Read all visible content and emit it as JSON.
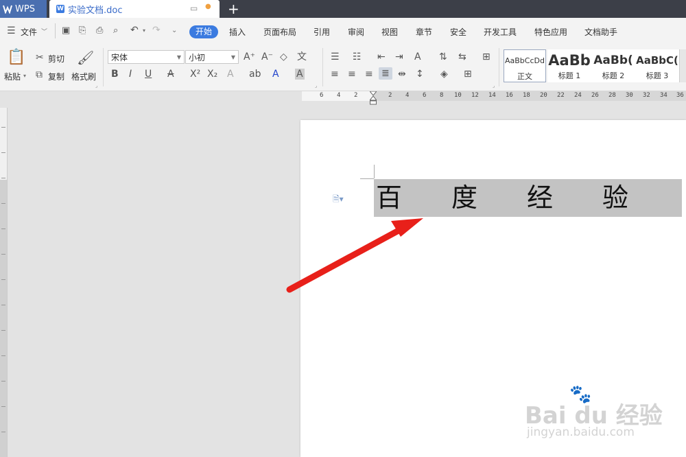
{
  "titlebar": {
    "app_tab": "WPS",
    "doc_tab": "实验文档.doc",
    "new_tab_symbol": "+"
  },
  "menubar": {
    "file_label": "文件",
    "items": [
      "开始",
      "插入",
      "页面布局",
      "引用",
      "审阅",
      "视图",
      "章节",
      "安全",
      "开发工具",
      "特色应用",
      "文档助手"
    ],
    "accent_color": "#3b7be0"
  },
  "toolbar": {
    "paste": "粘贴",
    "cut": "剪切",
    "copy": "复制",
    "format_painter": "格式刷",
    "font_name": "宋体",
    "font_size": "小初",
    "styles": [
      {
        "sample": "AaBbCcDd",
        "name": "正文"
      },
      {
        "sample": "AaBb",
        "name": "标题 1"
      },
      {
        "sample": "AaBb(",
        "name": "标题 2"
      },
      {
        "sample": "AaBbC(",
        "name": "标题 3"
      }
    ]
  },
  "ruler": {
    "numbers": [
      "6",
      "4",
      "2",
      "2",
      "4",
      "6",
      "8",
      "10",
      "12",
      "14",
      "16",
      "18",
      "20",
      "22",
      "24",
      "26",
      "28",
      "30",
      "32",
      "34",
      "36"
    ]
  },
  "document": {
    "chars": [
      "百",
      "度",
      "经",
      "验"
    ]
  },
  "watermark": {
    "brand": "Bai du 经验",
    "url": "jingyan.baidu.com"
  },
  "annotation": {
    "arrow_color": "#e8201a"
  }
}
